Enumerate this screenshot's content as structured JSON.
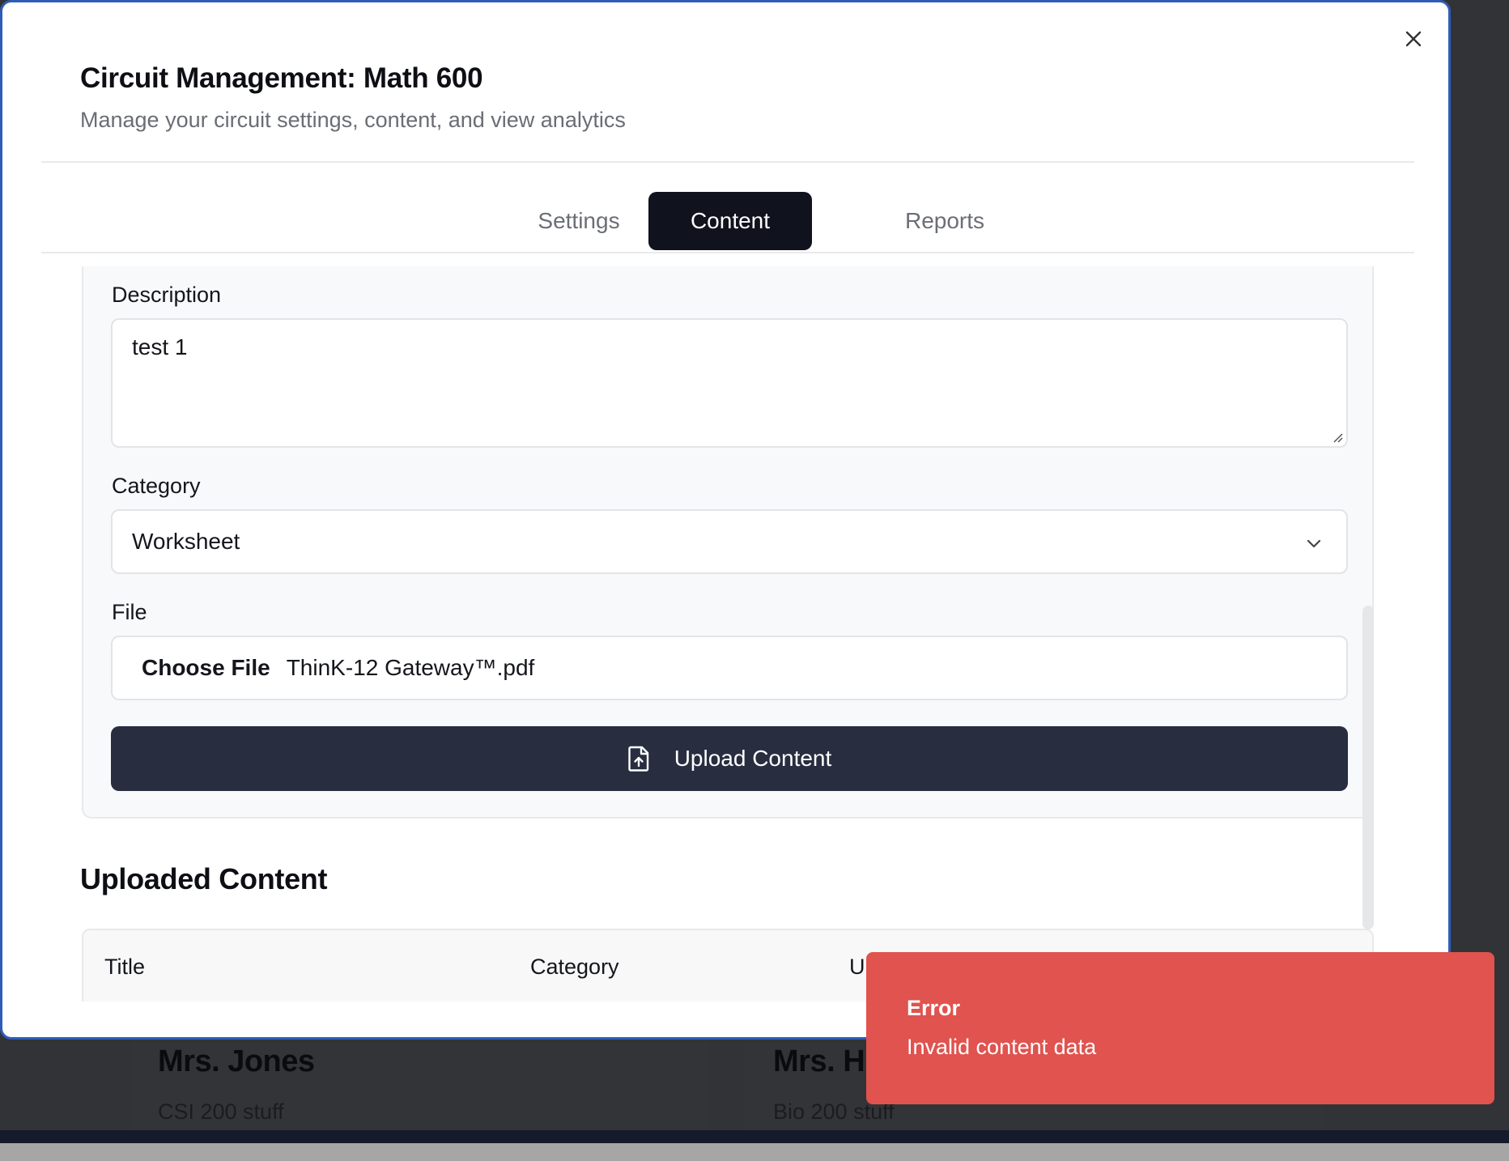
{
  "background": {
    "cards": [
      {
        "name": "Mrs. Jones",
        "subtitle": "CSI 200 stuff"
      },
      {
        "name": "Mrs. H",
        "subtitle": "Bio 200 stuff"
      }
    ]
  },
  "modal": {
    "title": "Circuit Management: Math 600",
    "subtitle": "Manage your circuit settings, content, and view analytics",
    "close_icon": "close-icon"
  },
  "tabs": [
    {
      "label": "Settings",
      "active": false
    },
    {
      "label": "Content",
      "active": true
    },
    {
      "label": "Reports",
      "active": false
    }
  ],
  "form": {
    "description_label": "Description",
    "description_value": "test 1",
    "category_label": "Category",
    "category_value": "Worksheet",
    "file_label": "File",
    "choose_file_label": "Choose File",
    "file_name": "ThinK-12 Gateway™.pdf",
    "upload_label": "Upload Content",
    "upload_icon": "file-upload-icon"
  },
  "uploaded": {
    "heading": "Uploaded Content",
    "columns": [
      "Title",
      "Category",
      "Up"
    ]
  },
  "toast": {
    "title": "Error",
    "message": "Invalid content data",
    "color": "#e0534f"
  },
  "colors": {
    "accent_dark": "#10131e",
    "button_dark": "#282e40",
    "modal_border": "#2d5db8"
  }
}
